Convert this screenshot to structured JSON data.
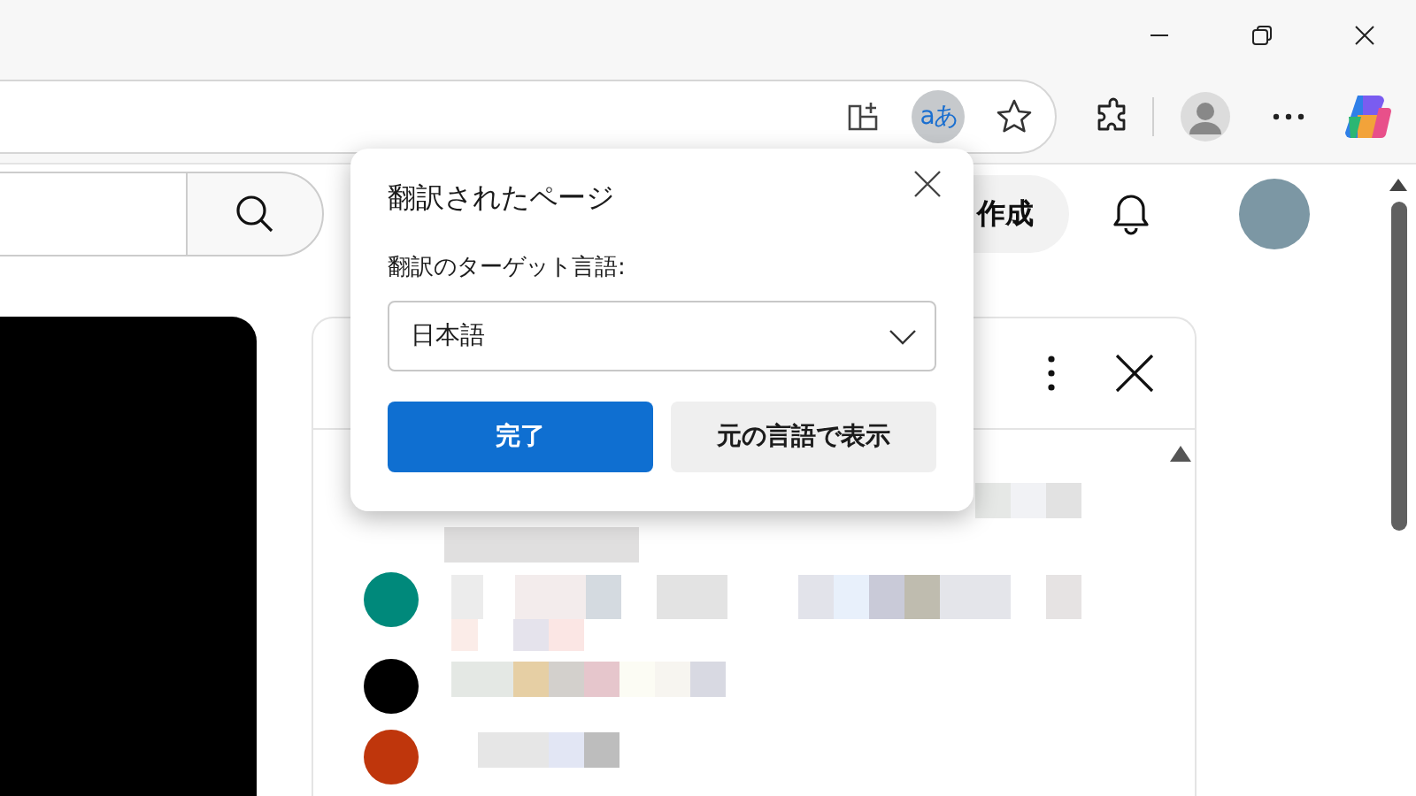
{
  "toolbar": {
    "translate_icon": {
      "label": "aあ",
      "active": true
    }
  },
  "page": {
    "create_button": "作成",
    "comments": [
      {
        "color": "#00897b"
      },
      {
        "color": "#000000"
      },
      {
        "color": "#bf360c"
      }
    ]
  },
  "popup": {
    "title": "翻訳されたページ",
    "field_label": "翻訳のターゲット言語:",
    "language": "日本語",
    "buttons": [
      {
        "label": "完了",
        "kind": "primary"
      },
      {
        "label": "元の言語で表示",
        "kind": "secondary"
      }
    ]
  }
}
